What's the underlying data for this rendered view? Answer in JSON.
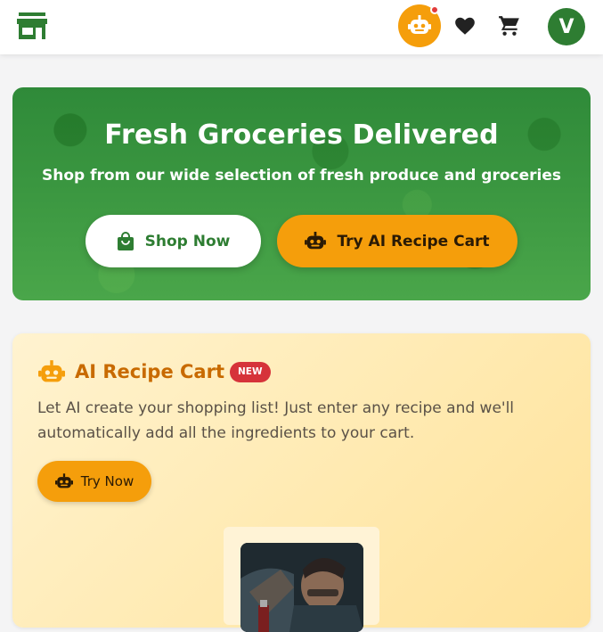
{
  "header": {
    "store_icon": "storefront-icon",
    "ai_button_icon": "robot-icon",
    "wishlist_icon": "heart-icon",
    "cart_icon": "cart-icon",
    "avatar_initial": "V"
  },
  "hero": {
    "title": "Fresh Groceries Delivered",
    "subtitle": "Shop from our wide selection of fresh produce and groceries",
    "shop_now_label": "Shop Now",
    "ai_recipe_label": "Try AI Recipe Cart"
  },
  "recipe_card": {
    "title": "AI Recipe Cart",
    "badge": "NEW",
    "description": "Let AI create your shopping list! Just enter any recipe and we'll automatically add all the ingredients to your cart.",
    "try_label": "Try Now"
  },
  "colors": {
    "brand_green": "#2e7d32",
    "accent_orange": "#f59e0b",
    "badge_red": "#d6333a",
    "card_title": "#c86a00"
  }
}
